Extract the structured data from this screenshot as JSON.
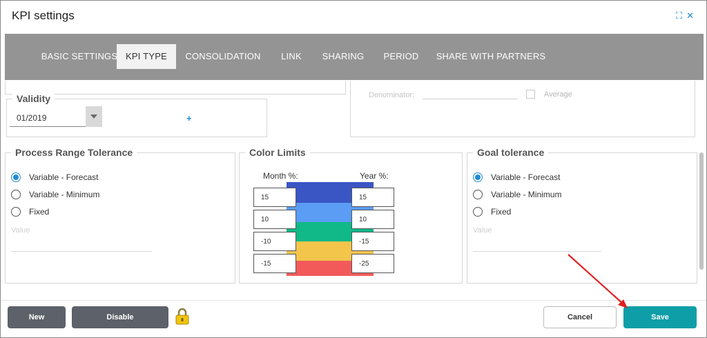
{
  "window": {
    "title": "KPI settings",
    "icons": [
      "maximize-icon",
      "close-icon"
    ],
    "maximize_glyph": "⛶",
    "close_glyph": "✕"
  },
  "tabs": [
    {
      "label": "BASIC SETTINGS",
      "active": false
    },
    {
      "label": "KPI TYPE",
      "active": true
    },
    {
      "label": "CONSOLIDATION",
      "active": false
    },
    {
      "label": "LINK",
      "active": false
    },
    {
      "label": "SHARING",
      "active": false
    },
    {
      "label": "PERIOD",
      "active": false
    },
    {
      "label": "SHARE WITH PARTNERS",
      "active": false
    }
  ],
  "validity": {
    "legend": "Validity",
    "value": "01/2019",
    "add_glyph": "+"
  },
  "denominator": {
    "label": "Denominator:",
    "average_label": "Average",
    "average_checked": false
  },
  "process_range_tolerance": {
    "legend": "Process Range Tolerance",
    "options": [
      {
        "label": "Variable - Forecast",
        "checked": true
      },
      {
        "label": "Variable - Minimum",
        "checked": false
      },
      {
        "label": "Fixed",
        "checked": false
      }
    ],
    "value_placeholder": "Value"
  },
  "color_limits": {
    "legend": "Color Limits",
    "month_label": "Month %:",
    "year_label": "Year %:",
    "month_values": [
      "15",
      "10",
      "-10",
      "-15"
    ],
    "year_values": [
      "15",
      "10",
      "-15",
      "-25"
    ],
    "band_colors": [
      "#3a55c4",
      "#5b9cf4",
      "#10b987",
      "#f3c54b",
      "#f25a5a"
    ]
  },
  "goal_tolerance": {
    "legend": "Goal tolerance",
    "options": [
      {
        "label": "Variable - Forecast",
        "checked": true
      },
      {
        "label": "Variable - Minimum",
        "checked": false
      },
      {
        "label": "Fixed",
        "checked": false
      }
    ],
    "value_placeholder": "Value"
  },
  "footer": {
    "new_label": "New",
    "disable_label": "Disable",
    "cancel_label": "Cancel",
    "save_label": "Save",
    "lock_icon": "lock-icon"
  },
  "colors": {
    "accent": "#1e8bd6",
    "tab_bar": "#949494",
    "save": "#0e9ea8",
    "dark_button": "#5d6169",
    "annotation_arrow": "#e02020"
  }
}
